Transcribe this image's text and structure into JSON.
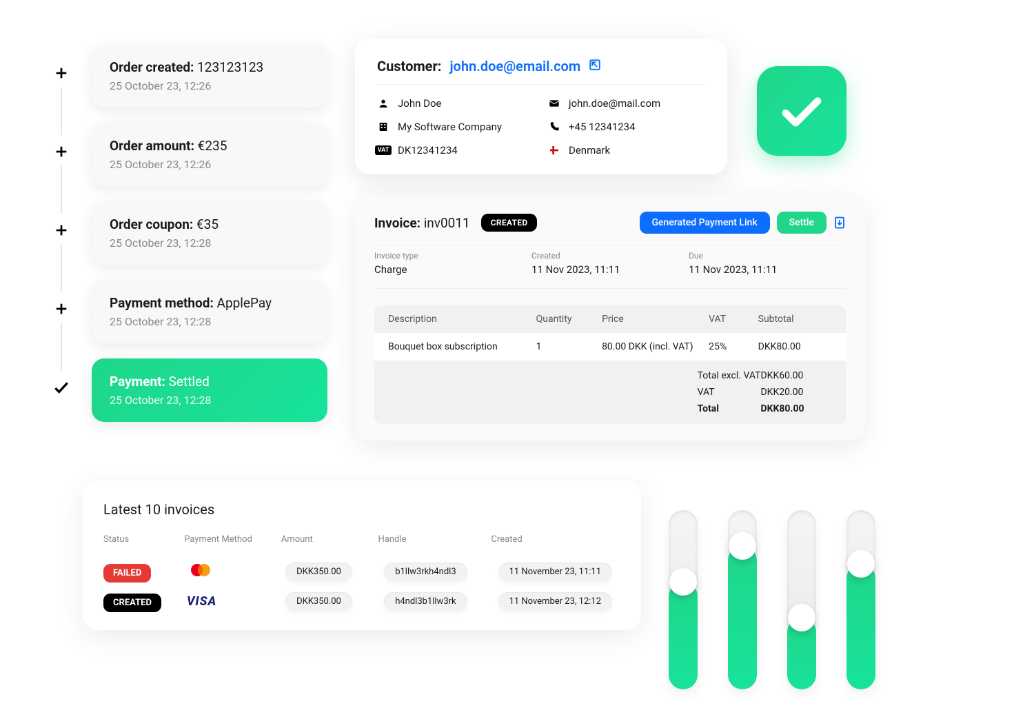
{
  "timeline": [
    {
      "label": "Order created:",
      "value": "123123123",
      "date": "25 October 23, 12:26",
      "settled": false
    },
    {
      "label": "Order amount:",
      "value": "€235",
      "date": "25 October 23, 12:26",
      "settled": false
    },
    {
      "label": "Order coupon:",
      "value": "€35",
      "date": "25 October 23, 12:28",
      "settled": false
    },
    {
      "label": "Payment method:",
      "value": "ApplePay",
      "date": "25 October 23, 12:28",
      "settled": false
    },
    {
      "label": "Payment:",
      "value": "Settled",
      "date": "25 October 23, 12:28",
      "settled": true
    }
  ],
  "customer": {
    "heading": "Customer:",
    "email_link": "john.doe@email.com",
    "name": "John Doe",
    "company": "My Software Company",
    "vat": "DK12341234",
    "email": "john.doe@mail.com",
    "phone": "+45 12341234",
    "country": "Denmark"
  },
  "invoice": {
    "title_label": "Invoice:",
    "title_value": "inv0011",
    "status": "CREATED",
    "actions": {
      "payment_link": "Generated Payment Link",
      "settle": "Settle"
    },
    "meta": {
      "type_label": "Invoice type",
      "type_value": "Charge",
      "created_label": "Created",
      "created_value": "11 Nov 2023,  11:11",
      "due_label": "Due",
      "due_value": "11 Nov 2023,  11:11"
    },
    "columns": {
      "desc": "Description",
      "qty": "Quantity",
      "price": "Price",
      "vat": "VAT",
      "subtotal": "Subtotal"
    },
    "line": {
      "desc": "Bouquet box subscription",
      "qty": "1",
      "price": "80.00 DKK (incl. VAT)",
      "vat": "25%",
      "subtotal": "DKK80.00"
    },
    "totals": {
      "excl_label": "Total excl. VAT",
      "excl_value": "DKK60.00",
      "vat_label": "VAT",
      "vat_value": "DKK20.00",
      "total_label": "Total",
      "total_value": "DKK80.00"
    }
  },
  "latest": {
    "title": "Latest 10 invoices",
    "head": {
      "status": "Status",
      "method": "Payment Method",
      "amount": "Amount",
      "handle": "Handle",
      "created": "Created"
    },
    "rows": [
      {
        "status": "FAILED",
        "status_class": "status-failed",
        "method": "mastercard",
        "amount": "DKK350.00",
        "handle": "b1llw3rkh4ndl3",
        "created": "11 November 23, 11:11"
      },
      {
        "status": "CREATED",
        "status_class": "status-created",
        "method": "visa",
        "amount": "DKK350.00",
        "handle": "h4ndl3b1llw3rk",
        "created": "11 November 23, 12:12"
      }
    ]
  }
}
